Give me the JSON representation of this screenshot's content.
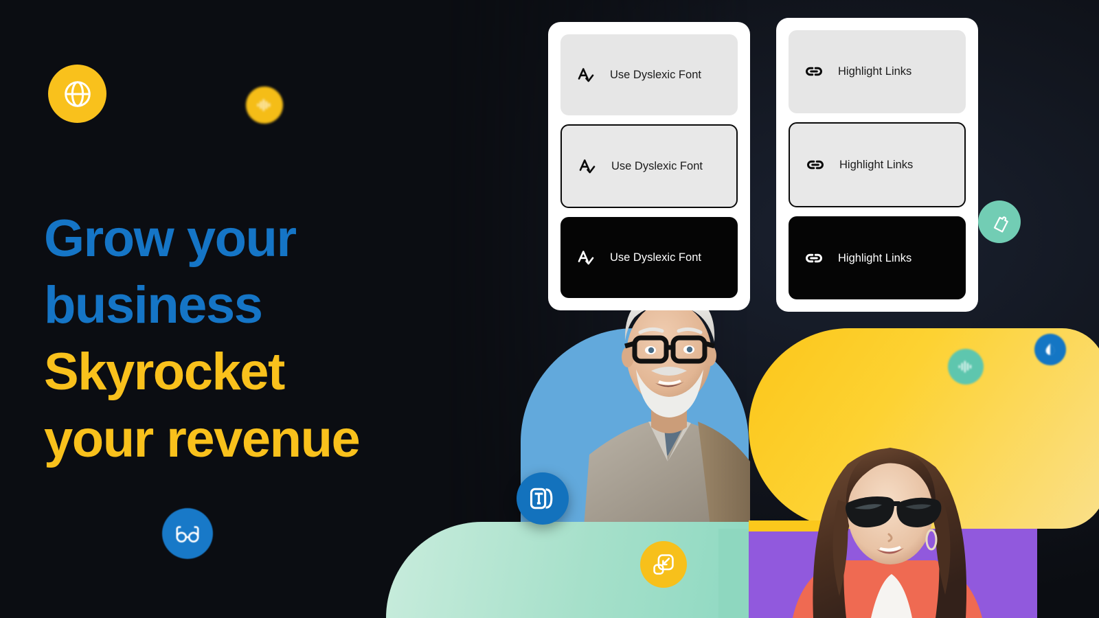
{
  "theme": {
    "background": "#0c0e13",
    "accent_blue": "#1575c6",
    "accent_yellow": "#f9c11c",
    "mint": "#8ed7bf",
    "purple": "#9159dd",
    "photo_blue": "#62a9dc"
  },
  "headline": {
    "line1": "Grow your",
    "line2": "business",
    "line3": "Skyrocket",
    "line4": "your revenue"
  },
  "badges": [
    {
      "name": "globe-icon",
      "color": "#f9c11c"
    },
    {
      "name": "audio-wave-icon",
      "color": "#f5bd17"
    },
    {
      "name": "glasses-icon",
      "color": "#1879c8"
    },
    {
      "name": "text-format-icon",
      "color": "#1372bd"
    },
    {
      "name": "resize-icon",
      "color": "#f7c01b"
    },
    {
      "name": "cursor-icon",
      "color": "#72cdb4"
    },
    {
      "name": "audio-wave-icon",
      "color": "#5ec6ae"
    },
    {
      "name": "contrast-droplet-icon",
      "color": "#1476c4"
    }
  ],
  "cards": [
    {
      "id": "dyslexic-font-card",
      "icon": "a-check-icon",
      "options": [
        {
          "state": "default",
          "label": "Use Dyslexic Font"
        },
        {
          "state": "outlined",
          "label": "Use Dyslexic Font"
        },
        {
          "state": "filled",
          "label": "Use Dyslexic Font"
        }
      ]
    },
    {
      "id": "highlight-links-card",
      "icon": "link-icon",
      "options": [
        {
          "state": "default",
          "label": "Highlight Links"
        },
        {
          "state": "outlined",
          "label": "Highlight Links"
        },
        {
          "state": "filled",
          "label": "Highlight Links"
        }
      ]
    }
  ],
  "photos": [
    {
      "name": "portrait-elderly-man",
      "alt": "Smiling elderly man with white beard and black glasses"
    },
    {
      "name": "portrait-young-woman",
      "alt": "Smiling young woman with long dark hair and sunglasses"
    }
  ]
}
